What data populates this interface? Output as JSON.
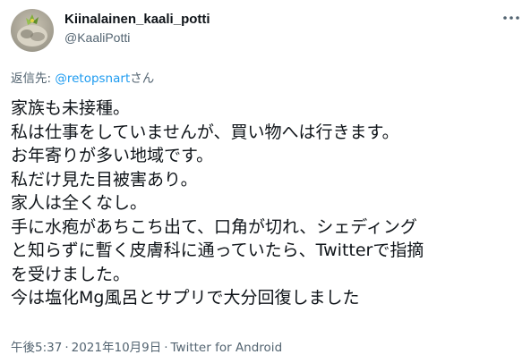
{
  "author": {
    "display_name": "Kiinalainen_kaali_potti",
    "handle": "@KaaliPotti"
  },
  "reply": {
    "prefix": "返信先: ",
    "mention": "@retopsnart",
    "suffix": "さん"
  },
  "tweet_lines": [
    "家族も未接種。",
    "私は仕事をしていませんが、買い物へは行きます。",
    "お年寄りが多い地域です。",
    "私だけ見た目被害あり。",
    "家人は全くなし。",
    "手に水疱があちこち出て、口角が切れ、シェディング",
    "と知らずに暫く皮膚科に通っていたら、Twitterで指摘",
    "を受けました。",
    "今は塩化Mg風呂とサプリで大分回復しました"
  ],
  "meta": {
    "time": "午後5:37",
    "date": "2021年10月9日",
    "source": "Twitter for Android",
    "separator": "·"
  },
  "icons": {
    "avatar": "profile-photo",
    "more": "more-horizontal-icon"
  }
}
